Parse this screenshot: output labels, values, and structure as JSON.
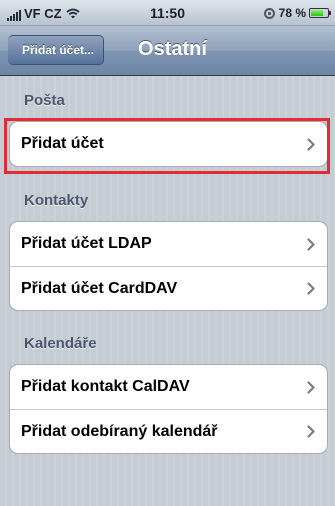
{
  "status_bar": {
    "carrier": "VF CZ",
    "time": "11:50",
    "battery": "78 %",
    "battery_level": 0.78
  },
  "nav_bar": {
    "back_label": "Přidat účet...",
    "title": "Ostatní"
  },
  "sections": {
    "mail": {
      "header": "Pošta",
      "items": [
        "Přidat účet"
      ]
    },
    "contacts": {
      "header": "Kontakty",
      "items": [
        "Přidat účet LDAP",
        "Přidat účet CardDAV"
      ]
    },
    "calendars": {
      "header": "Kalendáře",
      "items": [
        "Přidat kontakt CalDAV",
        "Přidat odebíraný kalendář"
      ]
    }
  },
  "colors": {
    "highlight": "#e12b36",
    "nav_bar": "#6d86a6",
    "background": "#c5ccd4"
  },
  "icons": {
    "row_disclosure": "chevron-right-icon"
  }
}
